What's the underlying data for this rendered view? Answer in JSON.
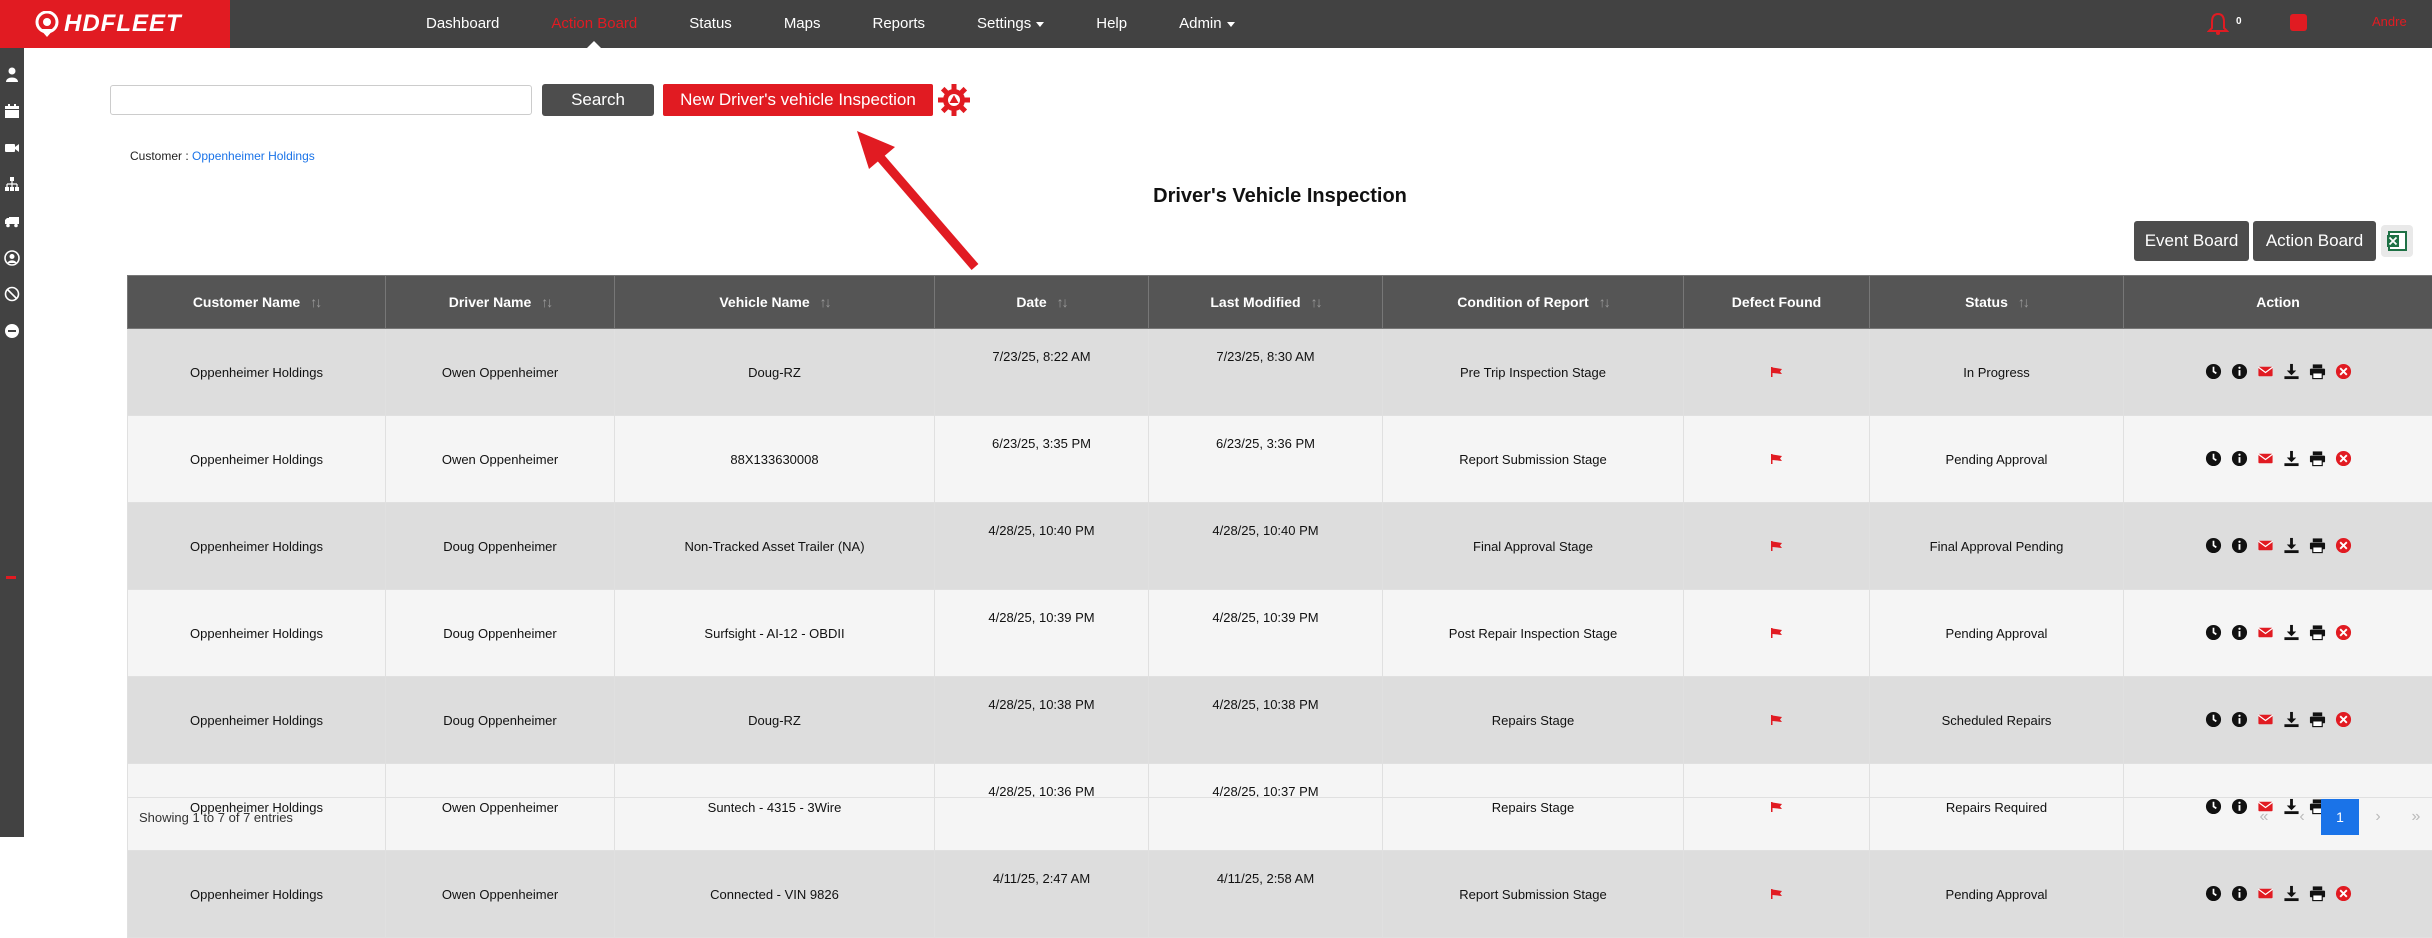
{
  "app": {
    "logo_text": "HDFLEET",
    "user_name": "Andre",
    "notification_count": "0"
  },
  "nav": {
    "items": [
      {
        "label": "Dashboard",
        "active": false,
        "dropdown": false
      },
      {
        "label": "Action Board",
        "active": true,
        "dropdown": false
      },
      {
        "label": "Status",
        "active": false,
        "dropdown": false
      },
      {
        "label": "Maps",
        "active": false,
        "dropdown": false
      },
      {
        "label": "Reports",
        "active": false,
        "dropdown": false
      },
      {
        "label": "Settings",
        "active": false,
        "dropdown": true
      },
      {
        "label": "Help",
        "active": false,
        "dropdown": false
      },
      {
        "label": "Admin",
        "active": false,
        "dropdown": true
      }
    ]
  },
  "sidebar": {
    "icons": [
      "user-icon",
      "calendar-icon",
      "video-icon",
      "hierarchy-icon",
      "truck-icon",
      "user-circle-icon",
      "tag-icon",
      "minus-circle-icon"
    ]
  },
  "toolbar": {
    "search_value": "",
    "search_label": "Search",
    "new_inspection_label": "New Driver's vehicle Inspection"
  },
  "customer": {
    "label": "Customer :",
    "name": "Oppenheimer Holdings"
  },
  "page_title": "Driver's Vehicle Inspection",
  "board_buttons": {
    "event_board": "Event Board",
    "action_board": "Action Board"
  },
  "table": {
    "columns": [
      "Customer Name",
      "Driver Name",
      "Vehicle Name",
      "Date",
      "Last Modified",
      "Condition of Report",
      "Defect Found",
      "Status",
      "Action"
    ],
    "rows": [
      {
        "customer": "Oppenheimer Holdings",
        "driver": "Owen Oppenheimer",
        "vehicle": "Doug-RZ",
        "date": "7/23/25, 8:22 AM",
        "modified": "7/23/25, 8:30 AM",
        "condition": "Pre Trip Inspection Stage",
        "status": "In Progress"
      },
      {
        "customer": "Oppenheimer Holdings",
        "driver": "Owen Oppenheimer",
        "vehicle": "88X133630008",
        "date": "6/23/25, 3:35 PM",
        "modified": "6/23/25, 3:36 PM",
        "condition": "Report Submission Stage",
        "status": "Pending Approval"
      },
      {
        "customer": "Oppenheimer Holdings",
        "driver": "Doug Oppenheimer",
        "vehicle": "Non-Tracked Asset Trailer (NA)",
        "date": "4/28/25, 10:40 PM",
        "modified": "4/28/25, 10:40 PM",
        "condition": "Final Approval Stage",
        "status": "Final Approval Pending"
      },
      {
        "customer": "Oppenheimer Holdings",
        "driver": "Doug Oppenheimer",
        "vehicle": "Surfsight - AI-12 - OBDII",
        "date": "4/28/25, 10:39 PM",
        "modified": "4/28/25, 10:39 PM",
        "condition": "Post Repair Inspection Stage",
        "status": "Pending Approval"
      },
      {
        "customer": "Oppenheimer Holdings",
        "driver": "Doug Oppenheimer",
        "vehicle": "Doug-RZ",
        "date": "4/28/25, 10:38 PM",
        "modified": "4/28/25, 10:38 PM",
        "condition": "Repairs Stage",
        "status": "Scheduled Repairs"
      },
      {
        "customer": "Oppenheimer Holdings",
        "driver": "Owen Oppenheimer",
        "vehicle": "Suntech - 4315 - 3Wire",
        "date": "4/28/25, 10:36 PM",
        "modified": "4/28/25, 10:37 PM",
        "condition": "Repairs Stage",
        "status": "Repairs Required"
      },
      {
        "customer": "Oppenheimer Holdings",
        "driver": "Owen Oppenheimer",
        "vehicle": "Connected - VIN 9826",
        "date": "4/11/25, 2:47 AM",
        "modified": "4/11/25, 2:58 AM",
        "condition": "Report Submission Stage",
        "status": "Pending Approval"
      }
    ]
  },
  "footer": {
    "info": "Showing 1 to 7 of 7 entries",
    "pages": {
      "first": "«",
      "prev": "‹",
      "current": "1",
      "next": "›",
      "last": "»"
    }
  },
  "colors": {
    "brand_red": "#e11b22",
    "topbar": "#424242",
    "link_blue": "#1a73e8"
  }
}
